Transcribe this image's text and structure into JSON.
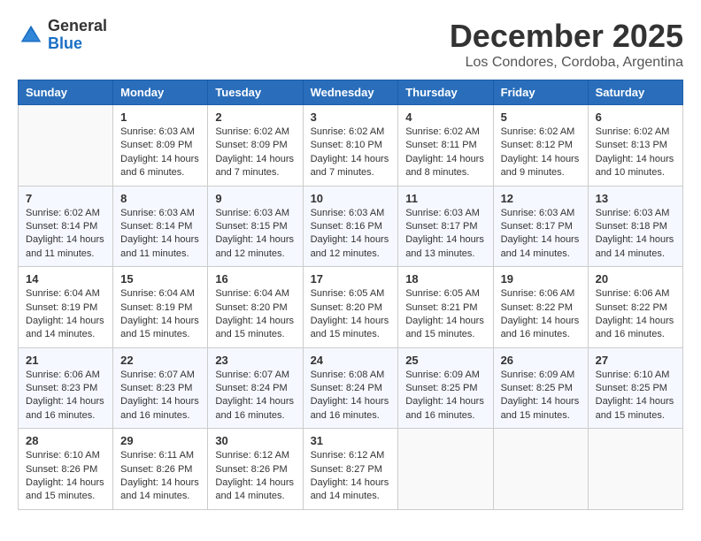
{
  "header": {
    "logo_general": "General",
    "logo_blue": "Blue",
    "month_title": "December 2025",
    "location": "Los Condores, Cordoba, Argentina"
  },
  "days_of_week": [
    "Sunday",
    "Monday",
    "Tuesday",
    "Wednesday",
    "Thursday",
    "Friday",
    "Saturday"
  ],
  "weeks": [
    [
      {
        "day": "",
        "sunrise": "",
        "sunset": "",
        "daylight": ""
      },
      {
        "day": "1",
        "sunrise": "Sunrise: 6:03 AM",
        "sunset": "Sunset: 8:09 PM",
        "daylight": "Daylight: 14 hours and 6 minutes."
      },
      {
        "day": "2",
        "sunrise": "Sunrise: 6:02 AM",
        "sunset": "Sunset: 8:09 PM",
        "daylight": "Daylight: 14 hours and 7 minutes."
      },
      {
        "day": "3",
        "sunrise": "Sunrise: 6:02 AM",
        "sunset": "Sunset: 8:10 PM",
        "daylight": "Daylight: 14 hours and 7 minutes."
      },
      {
        "day": "4",
        "sunrise": "Sunrise: 6:02 AM",
        "sunset": "Sunset: 8:11 PM",
        "daylight": "Daylight: 14 hours and 8 minutes."
      },
      {
        "day": "5",
        "sunrise": "Sunrise: 6:02 AM",
        "sunset": "Sunset: 8:12 PM",
        "daylight": "Daylight: 14 hours and 9 minutes."
      },
      {
        "day": "6",
        "sunrise": "Sunrise: 6:02 AM",
        "sunset": "Sunset: 8:13 PM",
        "daylight": "Daylight: 14 hours and 10 minutes."
      }
    ],
    [
      {
        "day": "7",
        "sunrise": "Sunrise: 6:02 AM",
        "sunset": "Sunset: 8:14 PM",
        "daylight": "Daylight: 14 hours and 11 minutes."
      },
      {
        "day": "8",
        "sunrise": "Sunrise: 6:03 AM",
        "sunset": "Sunset: 8:14 PM",
        "daylight": "Daylight: 14 hours and 11 minutes."
      },
      {
        "day": "9",
        "sunrise": "Sunrise: 6:03 AM",
        "sunset": "Sunset: 8:15 PM",
        "daylight": "Daylight: 14 hours and 12 minutes."
      },
      {
        "day": "10",
        "sunrise": "Sunrise: 6:03 AM",
        "sunset": "Sunset: 8:16 PM",
        "daylight": "Daylight: 14 hours and 12 minutes."
      },
      {
        "day": "11",
        "sunrise": "Sunrise: 6:03 AM",
        "sunset": "Sunset: 8:17 PM",
        "daylight": "Daylight: 14 hours and 13 minutes."
      },
      {
        "day": "12",
        "sunrise": "Sunrise: 6:03 AM",
        "sunset": "Sunset: 8:17 PM",
        "daylight": "Daylight: 14 hours and 14 minutes."
      },
      {
        "day": "13",
        "sunrise": "Sunrise: 6:03 AM",
        "sunset": "Sunset: 8:18 PM",
        "daylight": "Daylight: 14 hours and 14 minutes."
      }
    ],
    [
      {
        "day": "14",
        "sunrise": "Sunrise: 6:04 AM",
        "sunset": "Sunset: 8:19 PM",
        "daylight": "Daylight: 14 hours and 14 minutes."
      },
      {
        "day": "15",
        "sunrise": "Sunrise: 6:04 AM",
        "sunset": "Sunset: 8:19 PM",
        "daylight": "Daylight: 14 hours and 15 minutes."
      },
      {
        "day": "16",
        "sunrise": "Sunrise: 6:04 AM",
        "sunset": "Sunset: 8:20 PM",
        "daylight": "Daylight: 14 hours and 15 minutes."
      },
      {
        "day": "17",
        "sunrise": "Sunrise: 6:05 AM",
        "sunset": "Sunset: 8:20 PM",
        "daylight": "Daylight: 14 hours and 15 minutes."
      },
      {
        "day": "18",
        "sunrise": "Sunrise: 6:05 AM",
        "sunset": "Sunset: 8:21 PM",
        "daylight": "Daylight: 14 hours and 15 minutes."
      },
      {
        "day": "19",
        "sunrise": "Sunrise: 6:06 AM",
        "sunset": "Sunset: 8:22 PM",
        "daylight": "Daylight: 14 hours and 16 minutes."
      },
      {
        "day": "20",
        "sunrise": "Sunrise: 6:06 AM",
        "sunset": "Sunset: 8:22 PM",
        "daylight": "Daylight: 14 hours and 16 minutes."
      }
    ],
    [
      {
        "day": "21",
        "sunrise": "Sunrise: 6:06 AM",
        "sunset": "Sunset: 8:23 PM",
        "daylight": "Daylight: 14 hours and 16 minutes."
      },
      {
        "day": "22",
        "sunrise": "Sunrise: 6:07 AM",
        "sunset": "Sunset: 8:23 PM",
        "daylight": "Daylight: 14 hours and 16 minutes."
      },
      {
        "day": "23",
        "sunrise": "Sunrise: 6:07 AM",
        "sunset": "Sunset: 8:24 PM",
        "daylight": "Daylight: 14 hours and 16 minutes."
      },
      {
        "day": "24",
        "sunrise": "Sunrise: 6:08 AM",
        "sunset": "Sunset: 8:24 PM",
        "daylight": "Daylight: 14 hours and 16 minutes."
      },
      {
        "day": "25",
        "sunrise": "Sunrise: 6:09 AM",
        "sunset": "Sunset: 8:25 PM",
        "daylight": "Daylight: 14 hours and 16 minutes."
      },
      {
        "day": "26",
        "sunrise": "Sunrise: 6:09 AM",
        "sunset": "Sunset: 8:25 PM",
        "daylight": "Daylight: 14 hours and 15 minutes."
      },
      {
        "day": "27",
        "sunrise": "Sunrise: 6:10 AM",
        "sunset": "Sunset: 8:25 PM",
        "daylight": "Daylight: 14 hours and 15 minutes."
      }
    ],
    [
      {
        "day": "28",
        "sunrise": "Sunrise: 6:10 AM",
        "sunset": "Sunset: 8:26 PM",
        "daylight": "Daylight: 14 hours and 15 minutes."
      },
      {
        "day": "29",
        "sunrise": "Sunrise: 6:11 AM",
        "sunset": "Sunset: 8:26 PM",
        "daylight": "Daylight: 14 hours and 14 minutes."
      },
      {
        "day": "30",
        "sunrise": "Sunrise: 6:12 AM",
        "sunset": "Sunset: 8:26 PM",
        "daylight": "Daylight: 14 hours and 14 minutes."
      },
      {
        "day": "31",
        "sunrise": "Sunrise: 6:12 AM",
        "sunset": "Sunset: 8:27 PM",
        "daylight": "Daylight: 14 hours and 14 minutes."
      },
      {
        "day": "",
        "sunrise": "",
        "sunset": "",
        "daylight": ""
      },
      {
        "day": "",
        "sunrise": "",
        "sunset": "",
        "daylight": ""
      },
      {
        "day": "",
        "sunrise": "",
        "sunset": "",
        "daylight": ""
      }
    ]
  ]
}
